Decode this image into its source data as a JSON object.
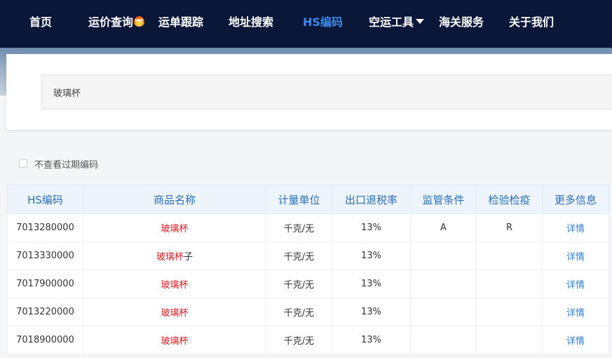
{
  "nav": {
    "items": [
      {
        "label": "首页"
      },
      {
        "label": "运价查询",
        "badge": "HOT"
      },
      {
        "label": "运单跟踪"
      },
      {
        "label": "地址搜索"
      },
      {
        "label": "HS编码",
        "active": true
      },
      {
        "label": "空运工具",
        "has_dropdown": true
      },
      {
        "label": "海关服务"
      },
      {
        "label": "关于我们"
      }
    ]
  },
  "search": {
    "value": "玻璃杯"
  },
  "filter": {
    "label": "不查看过期编码",
    "checked": false
  },
  "table": {
    "headers": [
      "HS编码",
      "商品名称",
      "计量单位",
      "出口退税率",
      "监管条件",
      "检验检疫",
      "更多信息"
    ],
    "rows": [
      {
        "code": "7013280000",
        "name_highlight": "玻璃杯",
        "name_rest": "",
        "unit": "千克/无",
        "rate": "13%",
        "supervision": "A",
        "inspection": "R",
        "more": "详情"
      },
      {
        "code": "7013330000",
        "name_highlight": "玻璃杯",
        "name_rest": "子",
        "unit": "千克/无",
        "rate": "13%",
        "supervision": "",
        "inspection": "",
        "more": "详情"
      },
      {
        "code": "7017900000",
        "name_highlight": "玻璃杯",
        "name_rest": "",
        "unit": "千克/无",
        "rate": "13%",
        "supervision": "",
        "inspection": "",
        "more": "详情"
      },
      {
        "code": "7013220000",
        "name_highlight": "玻璃杯",
        "name_rest": "",
        "unit": "千克/无",
        "rate": "13%",
        "supervision": "",
        "inspection": "",
        "more": "详情"
      },
      {
        "code": "7018900000",
        "name_highlight": "玻璃杯",
        "name_rest": "",
        "unit": "千克/无",
        "rate": "13%",
        "supervision": "",
        "inspection": "",
        "more": "详情"
      }
    ]
  },
  "colors": {
    "nav_bg": "#0a1738",
    "active": "#3d8be8",
    "highlight": "#d9181e",
    "link": "#2a7fd4",
    "header_text": "#2a6fb8"
  }
}
